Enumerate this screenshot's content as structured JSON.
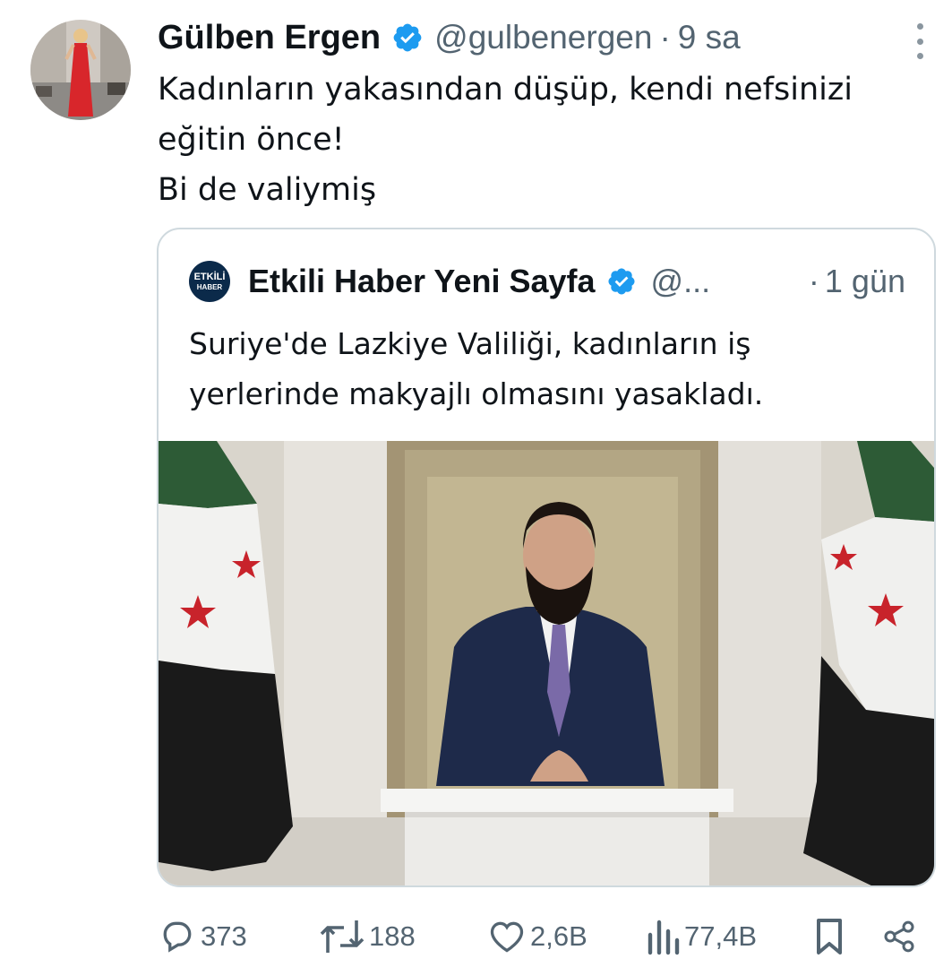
{
  "tweet": {
    "author_name": "Gülben Ergen",
    "handle": "@gulbenergen",
    "separator": "·",
    "time": "9 sa",
    "text_lines": [
      "Kadınların yakasından düşüp, kendi nefsinizi",
      "eğitin önce!",
      "Bi de valiymiş"
    ]
  },
  "quoted": {
    "logo_text_top": "ETKİLİ",
    "logo_text_bottom": "HABER",
    "author_name": "Etkili Haber Yeni Sayfa",
    "handle": "@...",
    "separator": "·",
    "time": "1 gün",
    "text_lines": [
      "Suriye'de Lazkiye Valiliği, kadınların iş",
      "yerlerinde makyajlı olmasını yasakladı."
    ]
  },
  "actions": {
    "replies": "373",
    "retweets": "188",
    "likes": "2,6B",
    "views": "77,4B"
  },
  "colors": {
    "verified": "#1d9bf0",
    "secondary_text": "#536471",
    "border": "#cfd9de"
  }
}
